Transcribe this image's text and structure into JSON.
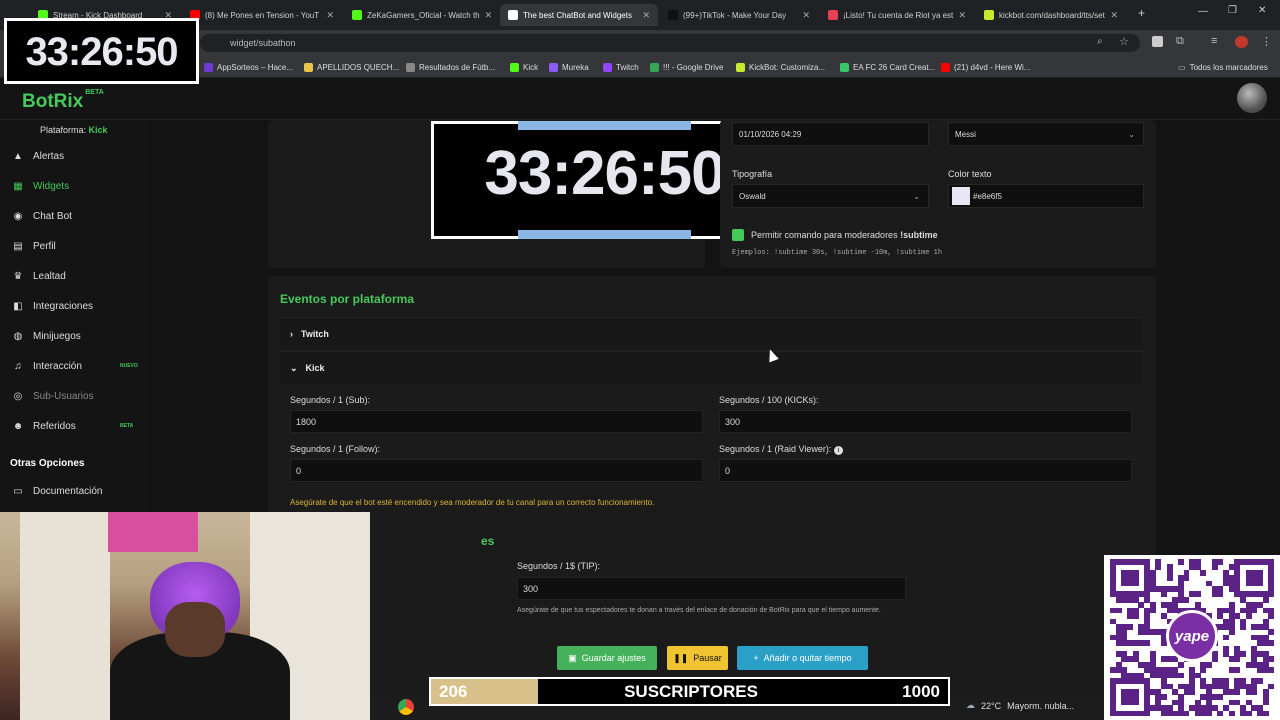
{
  "browser": {
    "tabs": [
      {
        "title": "Stream - Kick Dashboard",
        "color": "#53fc18"
      },
      {
        "title": "(8) Me Pones en Tension - YouT",
        "color": "#ff0000"
      },
      {
        "title": "ZeKaGamers_Oficial - Watch th",
        "color": "#53fc18"
      },
      {
        "title": "The best ChatBot and Widgets",
        "color": "#ffffff",
        "active": true
      },
      {
        "title": "(99+)TikTok - Make Your Day",
        "color": "#111111"
      },
      {
        "title": "¡Listo! Tu cuenta de Riot ya est",
        "color": "#e84057"
      },
      {
        "title": "kickbot.com/dashboard/tts/set",
        "color": "#c7e82c"
      }
    ],
    "url": "widget/subathon",
    "bookmarks": [
      {
        "label": "AppSorteos – Hace...",
        "color": "#6f3ad6"
      },
      {
        "label": "APELLIDOS QUECH...",
        "color": "#e9c44a"
      },
      {
        "label": "Resultados de Fútb...",
        "color": "#888888"
      },
      {
        "label": "Kick",
        "color": "#53fc18"
      },
      {
        "label": "Mureka",
        "color": "#8b5cf6"
      },
      {
        "label": "Twitch",
        "color": "#9146ff"
      },
      {
        "label": "!!! - Google Drive",
        "color": "#34a853"
      },
      {
        "label": "KickBot: Customiza...",
        "color": "#c7e82c"
      },
      {
        "label": "EA FC 26 Card Creat...",
        "color": "#3ac56c"
      },
      {
        "label": "(21) d4vd - Here Wi...",
        "color": "#ff0000"
      }
    ],
    "all_bookmarks": "Todos los marcadores"
  },
  "app": {
    "logo": "BotRix",
    "logo_badge": "BETA",
    "platform_label": "Plataforma:",
    "platform_value": "Kick"
  },
  "sidebar": {
    "items": [
      {
        "label": "Alertas",
        "icon": "▲",
        "state": "normal"
      },
      {
        "label": "Widgets",
        "icon": "▦",
        "state": "active"
      },
      {
        "label": "Chat Bot",
        "icon": "◉",
        "state": "normal"
      },
      {
        "label": "Perfil",
        "icon": "▤",
        "state": "normal"
      },
      {
        "label": "Lealtad",
        "icon": "♛",
        "state": "normal"
      },
      {
        "label": "Integraciones",
        "icon": "◧",
        "state": "normal"
      },
      {
        "label": "Minijuegos",
        "icon": "◍",
        "state": "normal"
      },
      {
        "label": "Interacción",
        "icon": "♫",
        "state": "normal",
        "badge": "NUEVO"
      },
      {
        "label": "Sub-Usuarios",
        "icon": "◎",
        "state": "disabled"
      },
      {
        "label": "Referidos",
        "icon": "☻",
        "state": "normal",
        "badge": "BETA"
      }
    ],
    "section_title": "Otras Opciones",
    "doc_label": "Documentación",
    "doc_icon": "▭"
  },
  "preview": {
    "time": "33:26:50"
  },
  "settings": {
    "date_value": "01/10/2026 04:29",
    "messi_value": "Messi",
    "font_label": "Tipografía",
    "font_value": "Oswald",
    "color_label": "Color texto",
    "color_value": "#e8e6f5",
    "mod_command_label": "Permitir comando para moderadores",
    "mod_command": "!subtime",
    "examples_label": "Ejemplos:",
    "examples": "!subtime 30s,  !subtime -10m,  !subtime 1h"
  },
  "events": {
    "title": "Eventos por plataforma",
    "twitch_label": "Twitch",
    "kick_label": "Kick",
    "kick": {
      "sub_label": "Segundos / 1 (Sub):",
      "sub_value": "1800",
      "kicks_label": "Segundos / 100 (KICKs):",
      "kicks_value": "300",
      "follow_label": "Segundos / 1 (Follow):",
      "follow_value": "0",
      "raid_label": "Segundos / 1 (Raid Viewer):",
      "raid_value": "0",
      "warning": "Asegúrate de que el bot esté encendido y sea moderador de tu canal para un correcto funcionamiento."
    },
    "partial_title_tail": "es",
    "tip_label": "Segundos / 1$ (TIP):",
    "tip_value": "300",
    "tip_note": "Asegúrate de que tus espectadores te donan a través del enlace de donación de BotRix para que el tiempo aumente."
  },
  "buttons": {
    "save": "Guardar ajustes",
    "pause": "Pausar",
    "add": "Añadir o quitar tiempo"
  },
  "overlay": {
    "timer": "33:26:50",
    "goal_current": "206",
    "goal_title": "SUSCRIPTORES",
    "goal_max": "1000",
    "goal_fraction": 0.206,
    "qr_brand": "yape",
    "weather_temp": "22°C",
    "weather_text": "Mayorm. nubla..."
  }
}
